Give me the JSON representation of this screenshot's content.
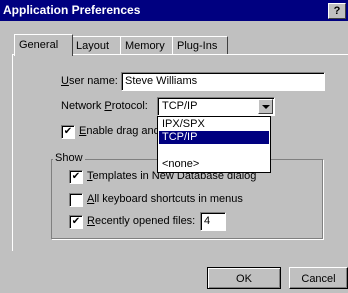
{
  "window": {
    "title": "Application Preferences",
    "help_button": "?"
  },
  "tabs": [
    {
      "label": "General",
      "active": true
    },
    {
      "label": "Layout",
      "active": false
    },
    {
      "label": "Memory",
      "active": false
    },
    {
      "label": "Plug-Ins",
      "active": false
    }
  ],
  "general": {
    "user_name": {
      "label_prefix": "",
      "label_u": "U",
      "label_rest": "ser name:",
      "value": "Steve Williams"
    },
    "network_protocol": {
      "label_pre": "Network ",
      "label_u": "P",
      "label_rest": "rotocol:",
      "selected": "TCP/IP"
    },
    "protocol_options": [
      {
        "label": "IPX/SPX",
        "selected": false
      },
      {
        "label": "TCP/IP",
        "selected": true
      },
      {
        "label": "",
        "selected": false
      },
      {
        "label": "<none>",
        "selected": false
      }
    ],
    "drag_drop": {
      "label_u": "E",
      "label_rest": "nable drag and",
      "checked": true,
      "check_glyph": "✔"
    }
  },
  "show_group": {
    "title": "Show",
    "templates": {
      "label_u": "T",
      "label_rest": "emplates in New Database dialog",
      "checked": true,
      "check_glyph": "✔"
    },
    "shortcuts": {
      "label_u": "A",
      "label_rest": "ll keyboard shortcuts in menus",
      "checked": false,
      "check_glyph": ""
    },
    "recent": {
      "label_u": "R",
      "label_rest": "ecently opened files:",
      "checked": true,
      "check_glyph": "✔",
      "count": "4"
    }
  },
  "buttons": {
    "ok": "OK",
    "cancel": "Cancel"
  }
}
